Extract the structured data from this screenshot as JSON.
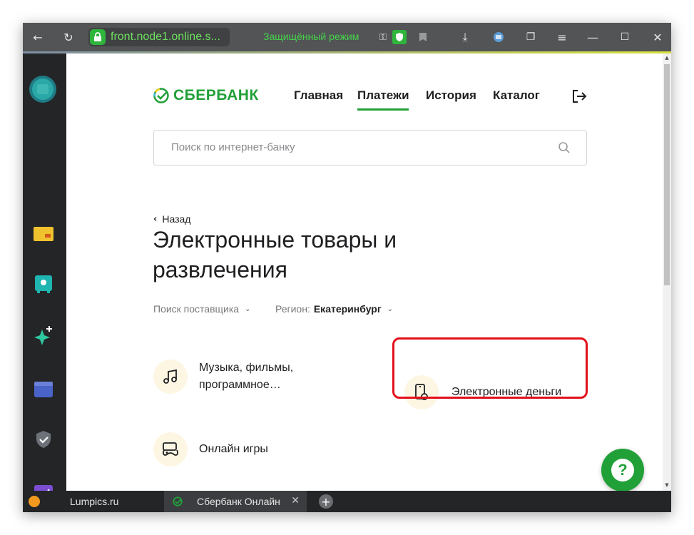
{
  "browser": {
    "url": "front.node1.online.s...",
    "secure_mode_label": "Защищённый режим",
    "icons": [
      "back-icon",
      "reload-icon",
      "lock-icon",
      "permissions-icon",
      "protect-icon",
      "bookmark-icon",
      "download-icon",
      "extension-icon",
      "collections-icon",
      "menu-icon",
      "minimize-icon",
      "maximize-icon",
      "close-icon"
    ]
  },
  "sidebar": {
    "items": [
      "profile-avatar-icon",
      "cards-icon",
      "wallet-icon",
      "sparkle-icon",
      "folder-icon",
      "shield-icon",
      "chart-icon"
    ]
  },
  "header": {
    "brand": "СБЕРБАНК",
    "nav": [
      "Главная",
      "Платежи",
      "История",
      "Каталог"
    ],
    "active_nav": "Платежи"
  },
  "search": {
    "placeholder": "Поиск по интернет-банку"
  },
  "page": {
    "back_label": "Назад",
    "title": "Электронные товары и развлечения",
    "filter_provider": "Поиск поставщика",
    "region_label": "Регион:",
    "region_value": "Екатеринбург"
  },
  "categories": [
    {
      "label": "Музыка, фильмы, программное…",
      "icon": "music-note-icon"
    },
    {
      "label": "Электронные деньги",
      "icon": "phone-money-icon",
      "highlighted": true
    },
    {
      "label": "Онлайн игры",
      "icon": "gamepad-icon"
    }
  ],
  "help": {
    "symbol": "?"
  },
  "tabs": [
    {
      "label": "Lumpics.ru",
      "active": false
    },
    {
      "label": "Сбербанк Онлайн",
      "active": true
    }
  ],
  "colors": {
    "brand_green": "#21a038",
    "highlight_red": "#e3101b",
    "topbar": "#525456",
    "sidebar": "#242527"
  }
}
